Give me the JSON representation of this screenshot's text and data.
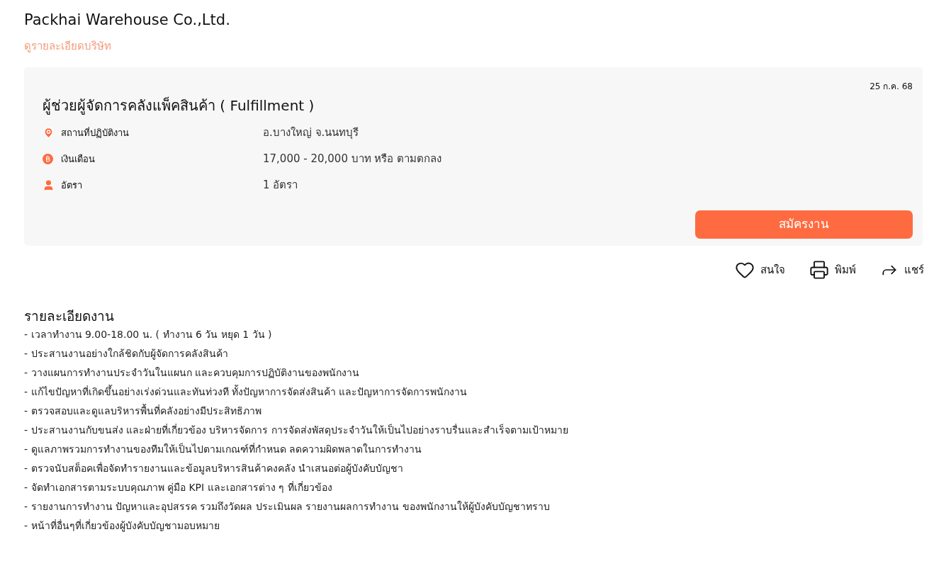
{
  "company": {
    "name": "Packhai Warehouse Co.,Ltd.",
    "details_link": "ดูรายละเอียดบริษัท"
  },
  "job": {
    "date": "25 ก.ค. 68",
    "title": "ผู้ช่วยผู้จัดการคลังแพ็คสินค้า ( Fulfillment )",
    "facts": [
      {
        "kind": "location",
        "label": "สถานที่ปฏิบัติงาน",
        "value": "อ.บางใหญ่ จ.นนทบุรี"
      },
      {
        "kind": "salary",
        "label": "เงินเดือน",
        "value": "17,000 - 20,000 บาท หรือ ตามตกลง"
      },
      {
        "kind": "positions",
        "label": "อัตรา",
        "value": "1 อัตรา"
      }
    ],
    "apply_button": "สมัครงาน"
  },
  "actions": [
    {
      "kind": "save",
      "label": "สนใจ"
    },
    {
      "kind": "print",
      "label": "พิมพ์"
    },
    {
      "kind": "share",
      "label": "แชร์"
    }
  ],
  "description": {
    "heading": "รายละเอียดงาน",
    "lines": [
      "- เวลาทำงาน 9.00-18.00 น. ( ทำงาน 6 วัน หยุด 1 วัน )",
      "- ประสานงานอย่างใกล้ชิดกับผู้จัดการคลังสินค้า",
      "- วางแผนการทำงานประจำวันในแผนก และควบคุมการปฏิบัติงานของพนักงาน",
      "- แก้ไขปัญหาที่เกิดขึ้นอย่างเร่งด่วนและทันท่วงที ทั้งปัญหาการจัดส่งสินค้า และปัญหาการจัดการพนักงาน",
      "- ตรวจสอบและดูแลบริหารพื้นที่คลังอย่างมีประสิทธิภาพ",
      "- ประสานงานกับขนส่ง และฝ่ายที่เกี่ยวข้อง บริหารจัดการ การจัดส่งพัสดุประจำวันให้เป็นไปอย่างราบรื่นและสำเร็จตามเป้าหมาย",
      "- ดูแลภาพรวมการทำงานของทีมให้เป็นไปตามเกณฑ์ที่กำหนด ลดความผิดพลาดในการทำงาน",
      "- ตรวจนับสต็อคเพื่อจัดทำรายงานและข้อมูลบริหารสินค้าคงคลัง นำเสนอต่อผู้บังคับบัญชา",
      "- จัดทำเอกสารตามระบบคุณภาพ คู่มือ KPI และเอกสารต่าง ๆ ที่เกี่ยวข้อง",
      "- รายงานการทำงาน ปัญหาและอุปสรรค รวมถึงวัดผล ประเมินผล รายงานผลการทำงาน ของพนักงานให้ผู้บังคับบัญชาทราบ",
      "- หน้าที่อื่นๆที่เกี่ยวข้องผู้บังคับบัญชามอบหมาย"
    ]
  }
}
